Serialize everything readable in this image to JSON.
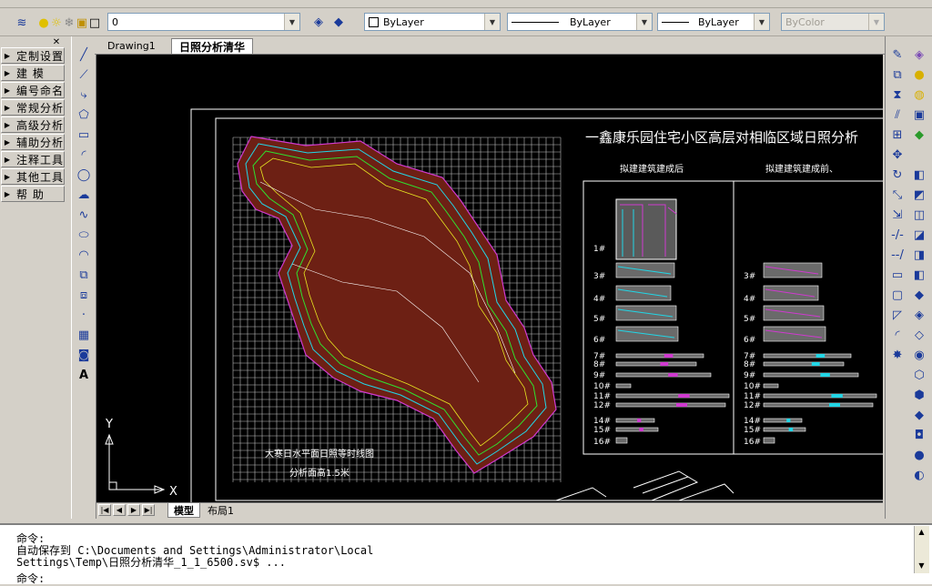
{
  "toolbar": {
    "layer_value": "0",
    "color_value": "ByLayer",
    "linetype_value": "ByLayer",
    "lineweight_value": "ByLayer",
    "plotstyle_value": "ByColor"
  },
  "left_menu": {
    "items": [
      {
        "label": "定制设置"
      },
      {
        "label": "建    模"
      },
      {
        "label": "编号命名"
      },
      {
        "label": "常规分析"
      },
      {
        "label": "高级分析"
      },
      {
        "label": "辅助分析"
      },
      {
        "label": "注释工具"
      },
      {
        "label": "其他工具"
      },
      {
        "label": "帮    助"
      }
    ]
  },
  "doc_tabs": [
    "Drawing1",
    "日照分析清华"
  ],
  "drawing": {
    "title": "一鑫康乐园住宅小区高层对相临区域日照分析",
    "col_after": "拟建建筑建成后",
    "col_before": "拟建建筑建成前、",
    "caption1": "大寒日水平面日照等时线图",
    "caption2": "分析面高1.5米",
    "axis_y": "Y",
    "axis_x": "X",
    "rows_after": [
      "1#",
      "3#",
      "4#",
      "5#",
      "6#",
      "7#",
      "8#",
      "9#",
      "10#",
      "11#",
      "12#",
      "14#",
      "15#",
      "16#"
    ],
    "rows_before": [
      "3#",
      "4#",
      "5#",
      "6#",
      "7#",
      "8#",
      "9#",
      "10#",
      "11#",
      "12#",
      "14#",
      "15#",
      "16#"
    ]
  },
  "layout_tabs": [
    "模型",
    "布局1"
  ],
  "command": {
    "line1": "命令:",
    "line2": "自动保存到 C:\\Documents and Settings\\Administrator\\Local",
    "line3": "Settings\\Temp\\日照分析清华_1_1_6500.sv$ ...",
    "line4": "命令:"
  },
  "colors": {
    "canvas": "#000000",
    "grid": "#ffffff",
    "brick": "#8b2a1a",
    "contour_green": "#2fe02f",
    "contour_cyan": "#22d6e6",
    "contour_magenta": "#d03ad0",
    "contour_yellow": "#e6e622"
  }
}
